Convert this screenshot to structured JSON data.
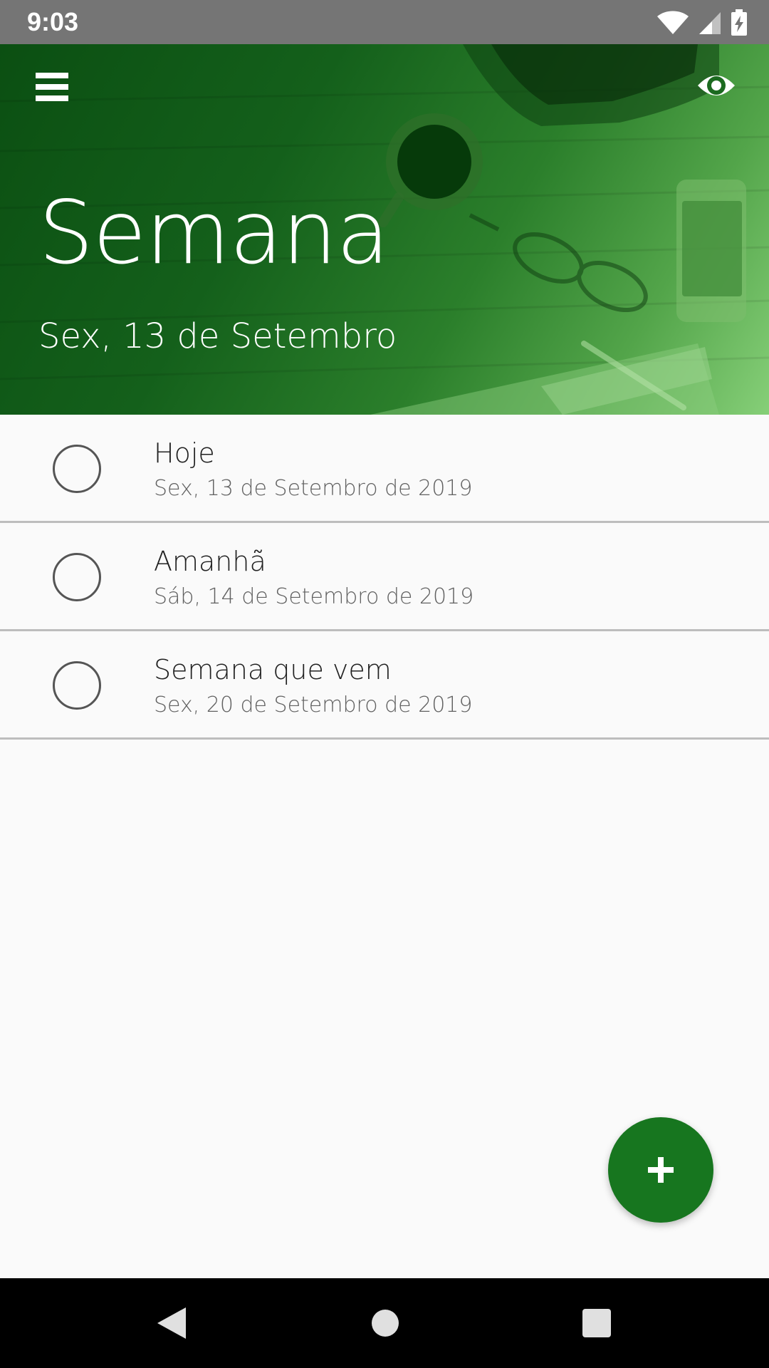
{
  "status_bar": {
    "time": "9:03",
    "icons": [
      "wifi-icon",
      "cell-signal-icon",
      "battery-charging-icon"
    ]
  },
  "header": {
    "title": "Semana",
    "subtitle": "Sex, 13 de Setembro",
    "menu_icon": "menu-icon",
    "visibility_icon": "eye-icon"
  },
  "tasks": [
    {
      "title": "Hoje",
      "date": "Sex, 13 de Setembro de 2019"
    },
    {
      "title": "Amanhã",
      "date": "Sáb, 14 de Setembro de 2019"
    },
    {
      "title": "Semana que vem",
      "date": "Sex, 20 de Setembro de 2019"
    }
  ],
  "fab": {
    "icon": "plus-icon"
  },
  "nav_bar": {
    "icons": [
      "back-icon",
      "home-icon",
      "recents-icon"
    ]
  },
  "colors": {
    "header_green": "#14601b",
    "fab_green": "#17761f",
    "status_bar": "#757575",
    "background": "#fafafa"
  }
}
